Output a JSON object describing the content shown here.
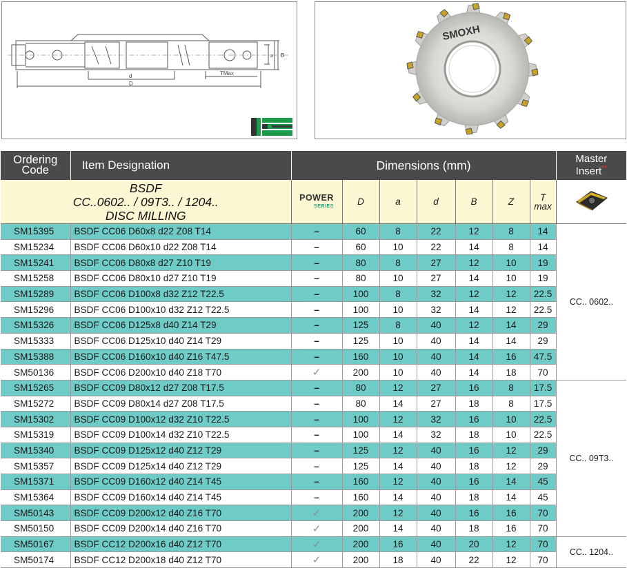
{
  "header": {
    "ordering_code": [
      "Ordering",
      "Code"
    ],
    "item_designation": "Item Designation",
    "dimensions": "Dimensions (mm)",
    "master_insert": [
      "Master",
      "Insert"
    ],
    "master_insert_marker": "**"
  },
  "subheader": {
    "title_lines": [
      "BSDF",
      "CC..0602.. / 09T3.. / 1204..",
      "DISC MILLING"
    ],
    "power_logo_top": "POWER",
    "power_logo_bottom": "SERIES",
    "columns": [
      "D",
      "a",
      "d",
      "B",
      "Z",
      "T max"
    ]
  },
  "drawing": {
    "labels": {
      "d": "d",
      "D": "D",
      "a": "a",
      "B": "B",
      "tmax": "TMax"
    },
    "colors": {
      "logo_green": "#1d9a4a",
      "logo_dark": "#333333"
    }
  },
  "photo": {
    "brand": "SMOXH"
  },
  "symbols": {
    "dash": "–",
    "check": "✓"
  },
  "colors": {
    "header_bg": "#4a4a4c",
    "teal_row": "#6fcbc6",
    "subheader_bg": "#fbf7d3",
    "stars": "#ff2b2b"
  },
  "groups": [
    {
      "label": "CC.. 0602..",
      "start": 0,
      "span": 10
    },
    {
      "label": "CC.. 09T3..",
      "start": 10,
      "span": 10
    },
    {
      "label": "CC.. 1204..",
      "start": 20,
      "span": 2
    }
  ],
  "rows": [
    {
      "code": "SM15395",
      "item": "BSDF CC06 D60x8 d22 Z08 T14",
      "power": "–",
      "D": "60",
      "a": "8",
      "d": "22",
      "B": "12",
      "Z": "8",
      "T": "14"
    },
    {
      "code": "SM15234",
      "item": "BSDF CC06 D60x10 d22 Z08 T14",
      "power": "–",
      "D": "60",
      "a": "10",
      "d": "22",
      "B": "14",
      "Z": "8",
      "T": "14"
    },
    {
      "code": "SM15241",
      "item": "BSDF CC06 D80x8 d27 Z10 T19",
      "power": "–",
      "D": "80",
      "a": "8",
      "d": "27",
      "B": "12",
      "Z": "10",
      "T": "19"
    },
    {
      "code": "SM15258",
      "item": "BSDF CC06 D80x10 d27 Z10 T19",
      "power": "–",
      "D": "80",
      "a": "10",
      "d": "27",
      "B": "14",
      "Z": "10",
      "T": "19"
    },
    {
      "code": "SM15289",
      "item": "BSDF CC06 D100x8 d32 Z12 T22.5",
      "power": "–",
      "D": "100",
      "a": "8",
      "d": "32",
      "B": "12",
      "Z": "12",
      "T": "22.5"
    },
    {
      "code": "SM15296",
      "item": "BSDF CC06 D100x10 d32 Z12 T22.5",
      "power": "–",
      "D": "100",
      "a": "10",
      "d": "32",
      "B": "14",
      "Z": "12",
      "T": "22.5"
    },
    {
      "code": "SM15326",
      "item": "BSDF CC06 D125x8 d40 Z14 T29",
      "power": "–",
      "D": "125",
      "a": "8",
      "d": "40",
      "B": "12",
      "Z": "14",
      "T": "29"
    },
    {
      "code": "SM15333",
      "item": "BSDF CC06 D125x10 d40 Z14 T29",
      "power": "–",
      "D": "125",
      "a": "10",
      "d": "40",
      "B": "14",
      "Z": "14",
      "T": "29"
    },
    {
      "code": "SM15388",
      "item": "BSDF CC06 D160x10 d40 Z16 T47.5",
      "power": "–",
      "D": "160",
      "a": "10",
      "d": "40",
      "B": "14",
      "Z": "16",
      "T": "47.5"
    },
    {
      "code": "SM50136",
      "item": "BSDF CC06 D200x10 d40 Z18 T70",
      "power": "✓",
      "D": "200",
      "a": "10",
      "d": "40",
      "B": "14",
      "Z": "18",
      "T": "70"
    },
    {
      "code": "SM15265",
      "item": "BSDF CC09 D80x12 d27 Z08 T17.5",
      "power": "–",
      "D": "80",
      "a": "12",
      "d": "27",
      "B": "16",
      "Z": "8",
      "T": "17.5"
    },
    {
      "code": "SM15272",
      "item": "BSDF CC09 D80x14 d27 Z08 T17.5",
      "power": "–",
      "D": "80",
      "a": "14",
      "d": "27",
      "B": "18",
      "Z": "8",
      "T": "17.5"
    },
    {
      "code": "SM15302",
      "item": "BSDF CC09 D100x12 d32 Z10 T22.5",
      "power": "–",
      "D": "100",
      "a": "12",
      "d": "32",
      "B": "16",
      "Z": "10",
      "T": "22.5"
    },
    {
      "code": "SM15319",
      "item": "BSDF CC09 D100x14 d32 Z10 T22.5",
      "power": "–",
      "D": "100",
      "a": "14",
      "d": "32",
      "B": "18",
      "Z": "10",
      "T": "22.5"
    },
    {
      "code": "SM15340",
      "item": "BSDF CC09 D125x12 d40 Z12 T29",
      "power": "–",
      "D": "125",
      "a": "12",
      "d": "40",
      "B": "16",
      "Z": "12",
      "T": "29"
    },
    {
      "code": "SM15357",
      "item": "BSDF CC09 D125x14 d40 Z12 T29",
      "power": "–",
      "D": "125",
      "a": "14",
      "d": "40",
      "B": "18",
      "Z": "12",
      "T": "29"
    },
    {
      "code": "SM15371",
      "item": "BSDF CC09 D160x12 d40 Z14 T45",
      "power": "–",
      "D": "160",
      "a": "12",
      "d": "40",
      "B": "16",
      "Z": "14",
      "T": "45"
    },
    {
      "code": "SM15364",
      "item": "BSDF CC09 D160x14 d40 Z14 T45",
      "power": "–",
      "D": "160",
      "a": "14",
      "d": "40",
      "B": "18",
      "Z": "14",
      "T": "45"
    },
    {
      "code": "SM50143",
      "item": "BSDF CC09 D200x12 d40 Z16 T70",
      "power": "✓",
      "D": "200",
      "a": "12",
      "d": "40",
      "B": "16",
      "Z": "16",
      "T": "70"
    },
    {
      "code": "SM50150",
      "item": "BSDF CC09 D200x14 d40 Z16 T70",
      "power": "✓",
      "D": "200",
      "a": "14",
      "d": "40",
      "B": "18",
      "Z": "16",
      "T": "70"
    },
    {
      "code": "SM50167",
      "item": "BSDF CC12 D200x16 d40 Z12 T70",
      "power": "✓",
      "D": "200",
      "a": "16",
      "d": "40",
      "B": "20",
      "Z": "12",
      "T": "70"
    },
    {
      "code": "SM50174",
      "item": "BSDF CC12 D200x18 d40 Z12 T70",
      "power": "✓",
      "D": "200",
      "a": "18",
      "d": "40",
      "B": "22",
      "Z": "12",
      "T": "70"
    }
  ]
}
